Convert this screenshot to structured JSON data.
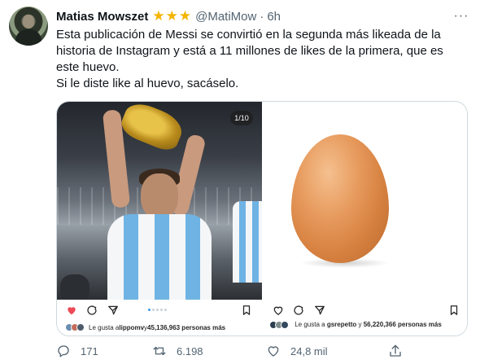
{
  "author": {
    "name": "Matias Mowszet",
    "stars": [
      "★",
      "★",
      "★"
    ],
    "handle": "@MatiMow",
    "separator": "·",
    "time": "6h"
  },
  "more_menu": "···",
  "tweet_text": [
    "Esta publicación de Messi se convirtió en la segunda más likeada de la historia de Instagram y está a 11 millones de likes de la primera, que es este huevo.",
    "Si le diste like al huevo, sacáselo."
  ],
  "media": {
    "left": {
      "counter": "1/10",
      "likes_prefix": "Le gusta a ",
      "likes_user": "lippomv",
      "likes_middle": " y ",
      "likes_count": "45,136,963 personas más",
      "heart_color": "#ed4956",
      "avatar_colors": [
        "#6a8caf",
        "#c46c5a",
        "#4d5b6b"
      ]
    },
    "right": {
      "likes_prefix": "Le gusta a ",
      "likes_user": "gsrepetto",
      "likes_middle": " y ",
      "likes_count": "56,220,366 personas más",
      "avatar_colors": [
        "#2c3e50",
        "#7f8c8d",
        "#34495e"
      ]
    }
  },
  "actions": {
    "reply_count": "171",
    "retweet_count": "6.198",
    "like_count": "24,8 mil",
    "share_count": ""
  },
  "colors": {
    "text_primary": "#0f1419",
    "text_secondary": "#536471",
    "star": "#f4b400",
    "border": "#cfd9de"
  }
}
